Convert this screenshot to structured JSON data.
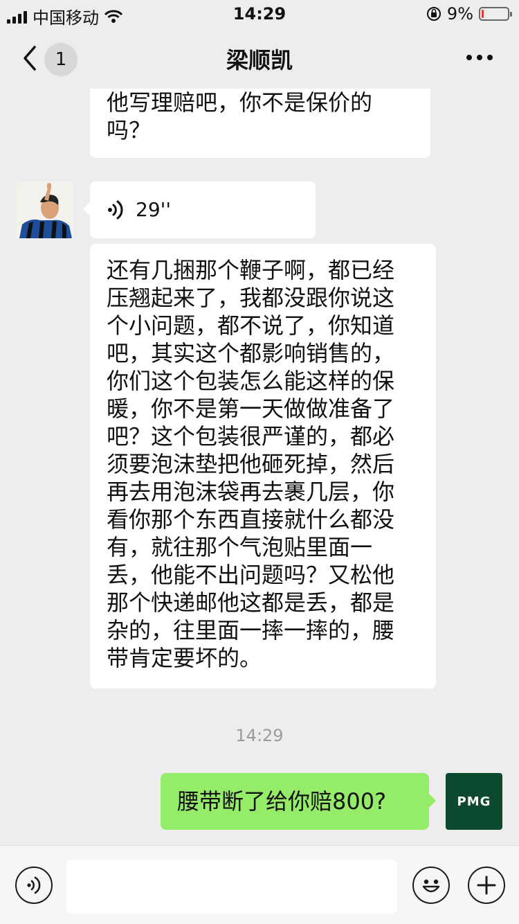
{
  "status_bar": {
    "carrier": "中国移动",
    "time": "14:29",
    "battery_percent": "9%",
    "battery_level": 0.09,
    "battery_color": "#e53935"
  },
  "nav": {
    "back_icon": "chevron-left-icon",
    "unread_count": "1",
    "title": "梁顺凯",
    "more_icon": "ellipsis-icon"
  },
  "messages": {
    "partial_incoming": "他写理赔吧，你不是保价的\n吗？",
    "voice": {
      "duration": "29''",
      "icon": "voice-wave-icon"
    },
    "long_incoming": "还有几捆那个鞭子啊，都已经\n压翘起来了，我都没跟你说这\n个小问题，都不说了，你知道\n吧，其实这个都影响销售的，\n你们这个包装怎么能这样的保\n暖，你不是第一天做做准备了\n吧？这个包装很严谨的，都必\n须要泡沫垫把他砸死掉，然后\n再去用泡沫袋再去裹几层，你\n看你那个东西直接就什么都没\n有，就往那个气泡贴里面一\n丢，他能不出问题吗？又松他\n那个快递邮他这都是丢，都是\n杂的，往里面一摔一摔的，腰\n带肯定要坏的。",
    "timestamp": "14:29",
    "outgoing": "腰带断了给你赔800?",
    "my_avatar_text": "PMG",
    "outgoing_color": "#95ec69"
  },
  "input_bar": {
    "voice_icon": "voice-input-icon",
    "value": "",
    "emoji_icon": "emoji-icon",
    "plus_icon": "plus-icon"
  }
}
